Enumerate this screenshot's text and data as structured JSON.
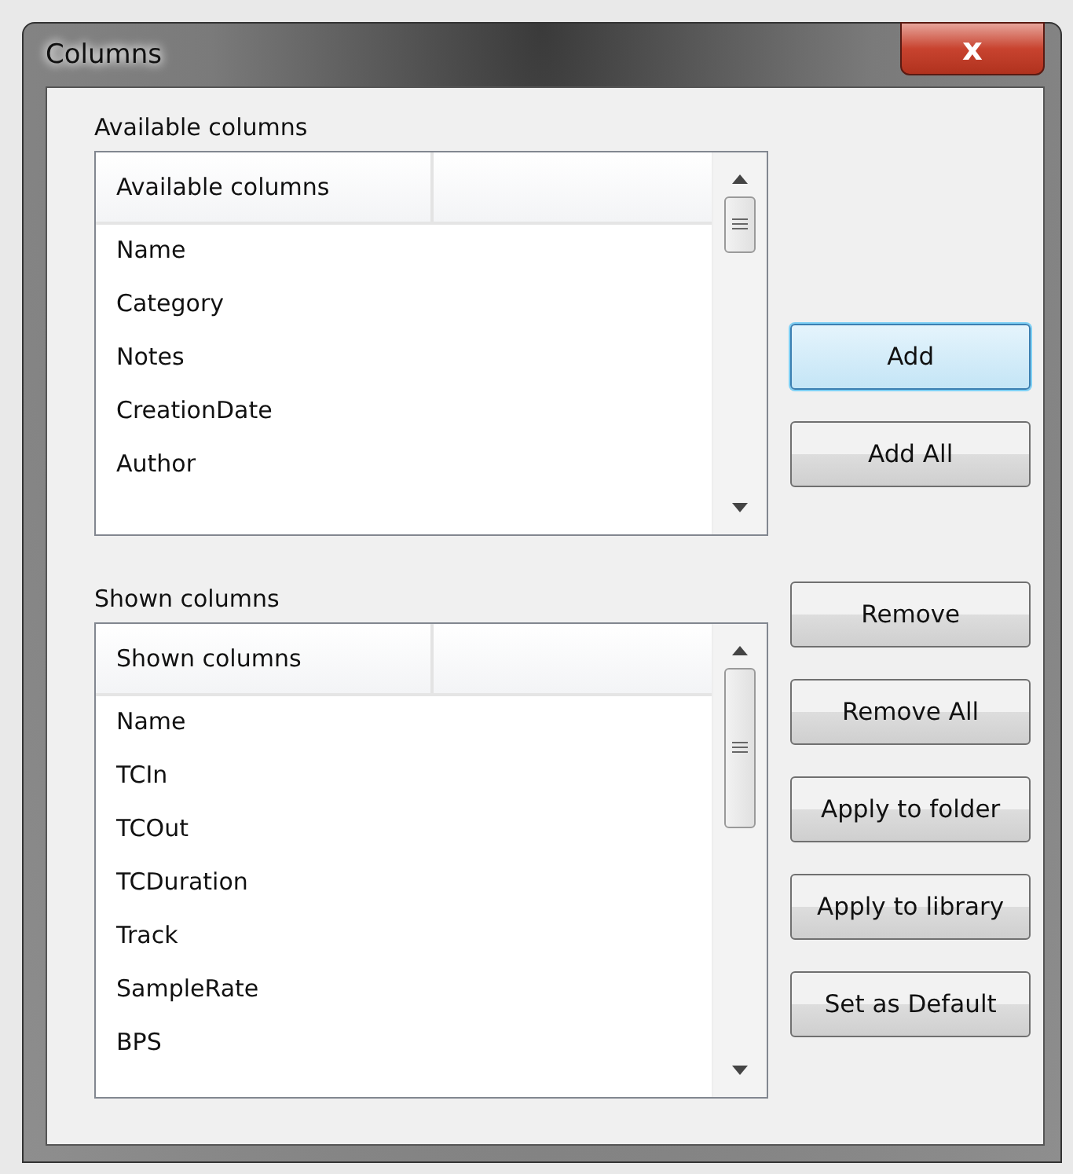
{
  "window": {
    "title": "Columns",
    "close_label": "x"
  },
  "lists": [
    {
      "label": "Available columns",
      "header": "Available columns",
      "items": [
        "Name",
        "Category",
        "Notes",
        "CreationDate",
        "Author"
      ]
    },
    {
      "label": "Shown columns",
      "header": "Shown columns",
      "items": [
        "Name",
        "TCIn",
        "TCOut",
        "TCDuration",
        "Track",
        "SampleRate",
        "BPS"
      ]
    }
  ],
  "button_groups": [
    [
      {
        "label": "Add",
        "focused": true
      },
      {
        "label": "Add All",
        "focused": false
      }
    ],
    [
      {
        "label": "Remove",
        "focused": false
      },
      {
        "label": "Remove All",
        "focused": false
      },
      {
        "label": "Apply to folder",
        "focused": false
      },
      {
        "label": "Apply to library",
        "focused": false
      },
      {
        "label": "Set as Default",
        "focused": false
      }
    ]
  ]
}
